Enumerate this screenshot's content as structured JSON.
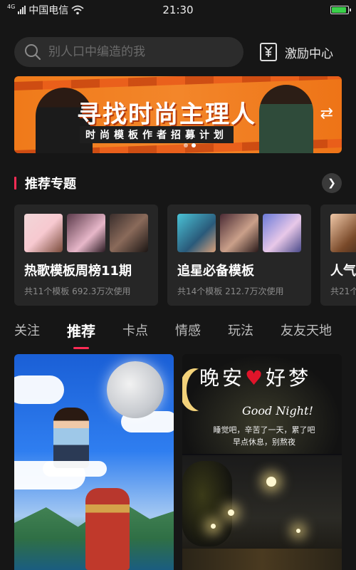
{
  "status_bar": {
    "network_tag": "4G",
    "carrier": "中国电信",
    "time": "21:30",
    "battery_level": 0.9,
    "battery_color": "#3ad04a"
  },
  "search": {
    "placeholder": "别人口中编造的我",
    "icon": "search-icon"
  },
  "incentive": {
    "label": "激励中心",
    "icon": "yuan-receipt-icon"
  },
  "banner": {
    "title": "寻找时尚主理人",
    "subtitle": "时尚模板作者招募计划",
    "slide_count": 2,
    "active_slide": 2
  },
  "recommended_topics": {
    "title": "推荐专题",
    "accent": "#fe2c55",
    "items": [
      {
        "name": "热歌模板周榜11期",
        "meta": "共11个模板 692.3万次使用"
      },
      {
        "name": "追星必备模板",
        "meta": "共14个模板 212.7万次使用"
      },
      {
        "name": "人气",
        "meta": "共21个"
      }
    ]
  },
  "tabs": {
    "items": [
      "关注",
      "推荐",
      "卡点",
      "情感",
      "玩法",
      "友友天地"
    ],
    "active_index": 1
  },
  "feed": {
    "cards": [
      {
        "kind": "moon-scene"
      },
      {
        "kind": "good-night",
        "title_left": "晚安",
        "title_heart": "♥",
        "title_right": "好梦",
        "english": "Good Night!",
        "poem_line1": "睡觉吧，辛苦了一天，累了吧",
        "poem_line2": "早点休息，别熬夜"
      }
    ]
  }
}
